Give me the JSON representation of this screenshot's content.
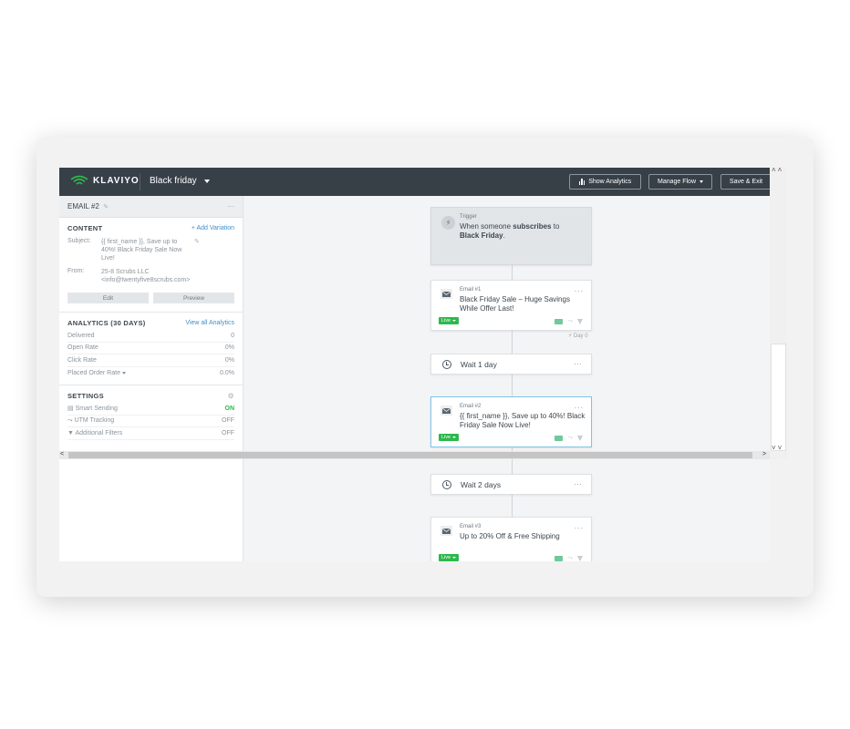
{
  "topbar": {
    "brand": "KLAVIYO",
    "flow_name": "Black friday",
    "show_analytics": "Show Analytics",
    "manage_flow": "Manage Flow",
    "save_exit": "Save & Exit"
  },
  "sidebar": {
    "header_title": "EMAIL #2",
    "header_more": "···",
    "content": {
      "title": "CONTENT",
      "add_variation": "+ Add Variation",
      "subject_label": "Subject:",
      "subject_value": "{{ first_name }}, Save up to 40%! Black Friday Sale Now Live!",
      "from_label": "From:",
      "from_name": "25-8 Scrubs LLC",
      "from_email": "<info@twentyfive8scrubs.com>",
      "edit": "Edit",
      "preview": "Preview"
    },
    "analytics": {
      "title": "ANALYTICS (30 DAYS)",
      "view_all": "View all Analytics",
      "rows": [
        {
          "label": "Delivered",
          "value": "0"
        },
        {
          "label": "Open Rate",
          "value": "0%"
        },
        {
          "label": "Click Rate",
          "value": "0%"
        },
        {
          "label": "Placed Order Rate",
          "value": "0.0%"
        }
      ]
    },
    "settings": {
      "title": "SETTINGS",
      "rows": [
        {
          "label": "Smart Sending",
          "value": "ON"
        },
        {
          "label": "UTM Tracking",
          "value": "OFF"
        },
        {
          "label": "Additional Filters",
          "value": "OFF"
        }
      ]
    }
  },
  "canvas": {
    "trigger": {
      "label": "Trigger",
      "text_pre": "When someone ",
      "text_bold1": "subscribes",
      "text_mid": " to ",
      "text_bold2": "Black Friday",
      "text_post": "."
    },
    "email1": {
      "label": "Email #1",
      "subject": "Black Friday Sale – Huge Savings While Offer Last!",
      "status": "Live",
      "day": "Day 0"
    },
    "wait1": {
      "text": "Wait 1 day"
    },
    "email2": {
      "label": "Email #2",
      "subject": "{{ first_name }}, Save up to 40%! Black Friday Sale Now Live!",
      "status": "Live"
    },
    "wait2": {
      "text": "Wait 2 days"
    },
    "email3": {
      "label": "Email #3",
      "subject": "Up to 20% Off & Free Shipping",
      "status": "Live"
    },
    "more": "···"
  },
  "colors": {
    "topbar_bg": "#373f47",
    "live_green": "#2db84c",
    "link_blue": "#3d8fc7",
    "selected_border": "#7cc4ea"
  }
}
